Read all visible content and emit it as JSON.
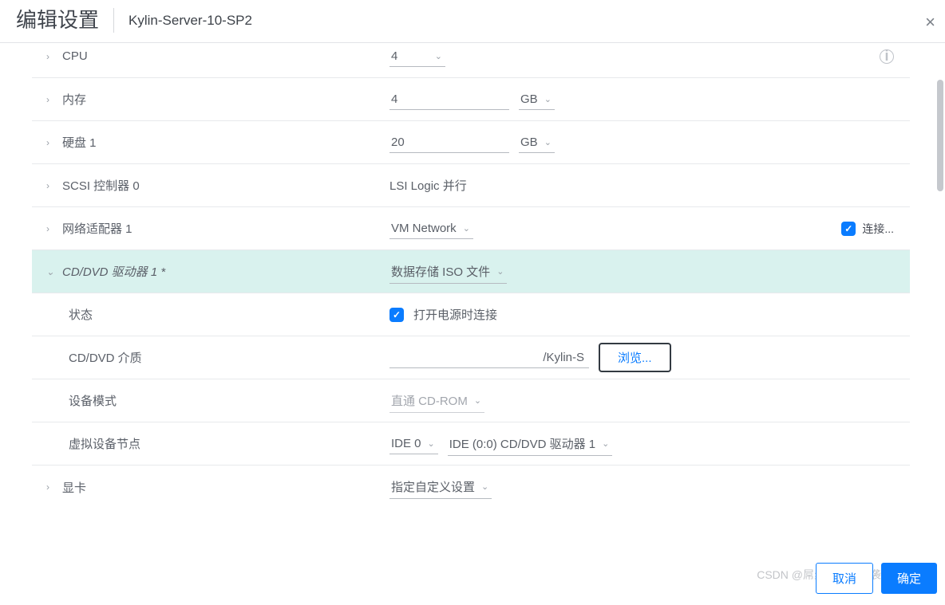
{
  "header": {
    "title": "编辑设置",
    "subtitle": "Kylin-Server-10-SP2",
    "close_icon": "×"
  },
  "rows": {
    "cpu": {
      "label": "CPU",
      "value": "4"
    },
    "memory": {
      "label": "内存",
      "value": "4",
      "unit": "GB"
    },
    "disk": {
      "label": "硬盘 1",
      "value": "20",
      "unit": "GB"
    },
    "scsi": {
      "label": "SCSI 控制器 0",
      "value": "LSI Logic 并行"
    },
    "net": {
      "label": "网络适配器 1",
      "value": "VM Network",
      "connect": "连接..."
    },
    "cddvd": {
      "label": "CD/DVD 驱动器 1 *",
      "value": "数据存储 ISO 文件",
      "status_label": "状态",
      "status_value": "打开电源时连接",
      "media_label": "CD/DVD 介质",
      "media_value": "/Kylin-S",
      "browse": "浏览...",
      "devmode_label": "设备模式",
      "devmode_value": "直通 CD-ROM",
      "node_label": "虚拟设备节点",
      "node_value1": "IDE 0",
      "node_value2": "IDE (0:0) CD/DVD 驱动器 1"
    },
    "video": {
      "label": "显卡",
      "value": "指定自定义设置"
    }
  },
  "footer": {
    "cancel": "取消",
    "ok": "确定"
  },
  "watermark": "CSDN @屌丝小帅的逆袭",
  "icons": {
    "check": "✓",
    "info": "i",
    "chev": "⌄",
    "caret": "›",
    "caret_down": "⌄"
  }
}
